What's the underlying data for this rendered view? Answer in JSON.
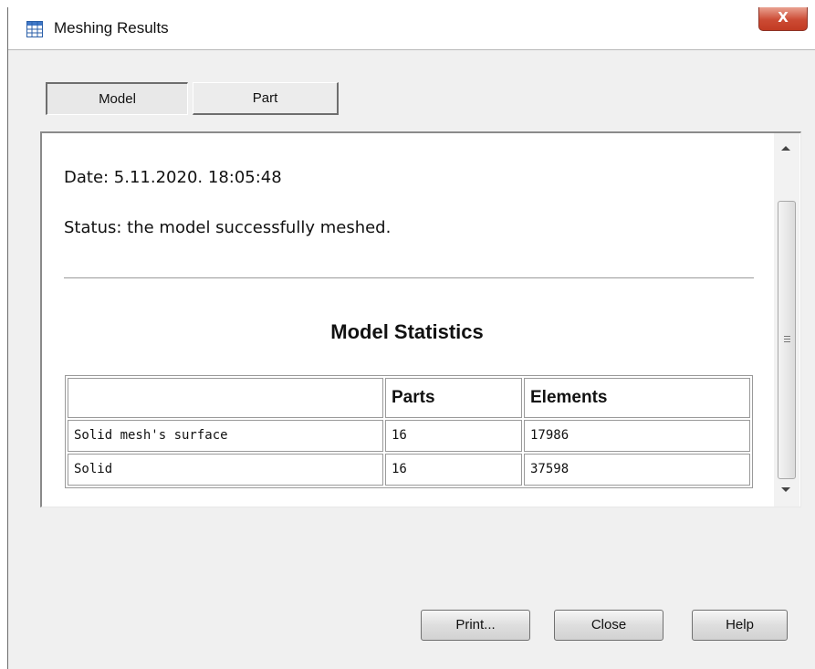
{
  "window": {
    "title": "Meshing Results",
    "close_glyph": "X",
    "icon": "table-icon"
  },
  "tabs": [
    {
      "label": "Model",
      "active": true
    },
    {
      "label": "Part",
      "active": false
    }
  ],
  "report": {
    "date_line": "Date: 5.11.2020. 18:05:48",
    "status_line": "Status: the model successfully meshed.",
    "stats_heading": "Model Statistics",
    "table": {
      "headers": [
        "",
        "Parts",
        "Elements"
      ],
      "rows": [
        [
          "Solid mesh's surface",
          "16",
          "17986"
        ],
        [
          "Solid",
          "16",
          "37598"
        ]
      ]
    }
  },
  "buttons": {
    "print": "Print...",
    "close": "Close",
    "help": "Help"
  }
}
